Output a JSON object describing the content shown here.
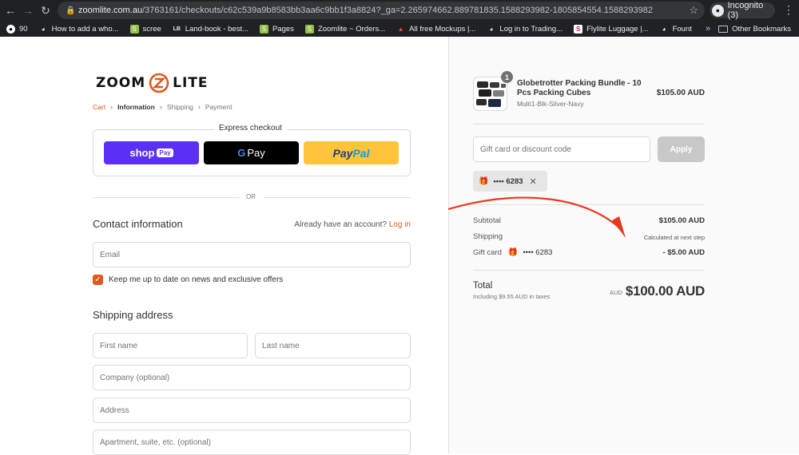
{
  "browser": {
    "url_host": "zoomlite.com.au",
    "url_path": "/3763161/checkouts/c62c539a9b8583bb3aa6c9bb1f3a8824?_ga=2.265974662.889781835.1588293982-1805854554.1588293982",
    "incognito_label": "Incognito (3)",
    "bookmarks": [
      {
        "label": "90",
        "icon": "github-icon"
      },
      {
        "label": "How to add a who...",
        "icon": "globe-icon"
      },
      {
        "label": "scree",
        "icon": "shopify-icon"
      },
      {
        "label": "Land-book - best...",
        "icon": "landbook-icon"
      },
      {
        "label": "Pages",
        "icon": "shopify-icon"
      },
      {
        "label": "Zoomlite ~ Orders...",
        "icon": "shopify-icon"
      },
      {
        "label": "All free Mockups |...",
        "icon": "mockups-icon"
      },
      {
        "label": "Log in to Trading...",
        "icon": "globe-icon"
      },
      {
        "label": "Flylite Luggage |...",
        "icon": "flylite-icon"
      },
      {
        "label": "Fount",
        "icon": "globe-icon"
      }
    ],
    "other_bookmarks": "Other Bookmarks"
  },
  "brand": {
    "left": "ZOOM",
    "right": "LITE",
    "accent": "#e0581e"
  },
  "breadcrumb": {
    "cart": "Cart",
    "information": "Information",
    "shipping": "Shipping",
    "payment": "Payment"
  },
  "express": {
    "title": "Express checkout",
    "shop": "shop",
    "shop_pill": "Pay",
    "gpay_g": "G",
    "gpay": "Pay",
    "paypal_1": "Pay",
    "paypal_2": "Pal"
  },
  "or": "OR",
  "contact": {
    "title": "Contact information",
    "have_account": "Already have an account?",
    "login": "Log in",
    "email_placeholder": "Email",
    "newsletter": "Keep me up to date on news and exclusive offers"
  },
  "shipping": {
    "title": "Shipping address",
    "first_name": "First name",
    "last_name": "Last name",
    "company": "Company (optional)",
    "address": "Address",
    "apartment": "Apartment, suite, etc. (optional)"
  },
  "summary": {
    "product": {
      "name": "Globetrotter Packing Bundle - 10 Pcs Packing Cubes",
      "variant": "Multi1-Blk-Silver-Navy",
      "price": "$105.00 AUD",
      "quantity": "1"
    },
    "gift_placeholder": "Gift card or discount code",
    "apply": "Apply",
    "applied_code": "•••• 6283",
    "subtotal_label": "Subtotal",
    "subtotal": "$105.00 AUD",
    "shipping_label": "Shipping",
    "shipping_value": "Calculated at next step",
    "giftcard_label": "Gift card",
    "giftcard_code": "•••• 6283",
    "giftcard_value": "- $5.00 AUD",
    "total_label": "Total",
    "total_taxes": "Including $9.55 AUD in taxes",
    "total_currency": "AUD",
    "total": "$100.00 AUD"
  },
  "annotation_arrow_color": "#e8391d"
}
